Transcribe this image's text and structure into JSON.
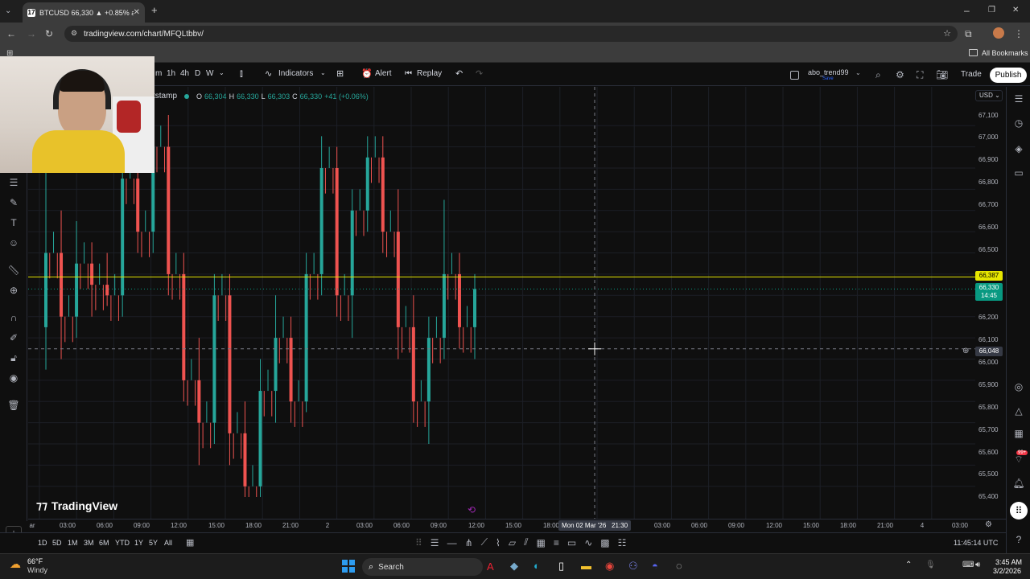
{
  "browser": {
    "tab_title": "BTCUSD 66,330 ▲ +0.85% abo...",
    "url": "tradingview.com/chart/MFQLtbbv/",
    "bookmarks_label": "All Bookmarks"
  },
  "toolbar": {
    "intervals": [
      "m",
      "1h",
      "4h",
      "D",
      "W"
    ],
    "indicators_label": "Indicators",
    "alert_label": "Alert",
    "replay_label": "Replay",
    "layout_name": "abo_trend99",
    "layout_sub": "Save",
    "trade_label": "Trade",
    "publish_label": "Publish"
  },
  "legend": {
    "exchange": "tstamp",
    "o_label": "O",
    "o_value": "66,304",
    "h_label": "H",
    "h_value": "66,330",
    "l_label": "L",
    "l_value": "66,303",
    "c_label": "C",
    "c_value": "66,330",
    "change": "+41 (+0.06%)"
  },
  "currency": "USD",
  "price_axis": {
    "ticks": [
      "67,100",
      "67,000",
      "66,900",
      "66,800",
      "66,700",
      "66,600",
      "66,500",
      "66,387",
      "66,330",
      "66,200",
      "66,100",
      "66,048",
      "66,000",
      "65,900",
      "65,800",
      "65,700",
      "65,600",
      "65,500",
      "65,400"
    ],
    "yellow_line_label": "66,387",
    "last_price_label": "66,330",
    "countdown_label": "14:45",
    "crosshair_label": "66,048"
  },
  "time_axis": {
    "ticks": [
      "ar",
      "03:00",
      "06:00",
      "09:00",
      "12:00",
      "15:00",
      "18:00",
      "21:00",
      "2",
      "03:00",
      "06:00",
      "09:00",
      "12:00",
      "15:00",
      "18:00",
      "03:00",
      "06:00",
      "09:00",
      "12:00",
      "15:00",
      "18:00",
      "21:00",
      "4",
      "03:00"
    ],
    "crosshair_label": "Mon 02 Mar '26   21:30"
  },
  "watermark": "TradingView",
  "bottombar": {
    "ranges": [
      "1D",
      "5D",
      "1M",
      "3M",
      "6M",
      "YTD",
      "1Y",
      "5Y",
      "All"
    ],
    "clock": "11:45:14 UTC"
  },
  "taskbar": {
    "weather_temp": "66°F",
    "weather_desc": "Windy",
    "search_label": "Search",
    "time": "3:45 AM",
    "date": "3/2/2026",
    "notif_badge": "99+"
  },
  "colors": {
    "up": "#26a69a",
    "down": "#ef5350",
    "yellow_line": "#e6e600",
    "last_price": "#089981",
    "chart_bg": "#0f0f0f"
  },
  "chart_data": {
    "type": "candlestick",
    "symbol": "BTCUSD",
    "ylim": [
      65350,
      67150
    ],
    "horizontal_line": 66387,
    "last_price": 66330,
    "crosshair_price": 66048,
    "crosshair_time": "Mon 02 Mar '26 21:30",
    "series": [
      {
        "c": "u",
        "o": 66150,
        "h": 66900,
        "l": 65950,
        "cl": 66500
      },
      {
        "c": "d",
        "o": 66500,
        "h": 66700,
        "l": 66000,
        "cl": 66200
      },
      {
        "c": "u",
        "o": 66200,
        "h": 66650,
        "l": 66100,
        "cl": 66450
      },
      {
        "c": "d",
        "o": 66450,
        "h": 66550,
        "l": 66200,
        "cl": 66350
      },
      {
        "c": "d",
        "o": 66350,
        "h": 66500,
        "l": 66250,
        "cl": 66300
      },
      {
        "c": "u",
        "o": 66300,
        "h": 67200,
        "l": 66200,
        "cl": 66850
      },
      {
        "c": "d",
        "o": 66850,
        "h": 67200,
        "l": 66500,
        "cl": 66600
      },
      {
        "c": "u",
        "o": 66600,
        "h": 67200,
        "l": 66500,
        "cl": 67000
      },
      {
        "c": "d",
        "o": 67000,
        "h": 67200,
        "l": 66300,
        "cl": 66400
      },
      {
        "c": "d",
        "o": 66400,
        "h": 66500,
        "l": 65800,
        "cl": 65900
      },
      {
        "c": "d",
        "o": 65900,
        "h": 66100,
        "l": 65500,
        "cl": 65700
      },
      {
        "c": "u",
        "o": 65700,
        "h": 66400,
        "l": 65600,
        "cl": 66300
      },
      {
        "c": "d",
        "o": 66300,
        "h": 66400,
        "l": 65500,
        "cl": 65650
      },
      {
        "c": "d",
        "o": 65650,
        "h": 65800,
        "l": 65350,
        "cl": 65400
      },
      {
        "c": "u",
        "o": 65400,
        "h": 66000,
        "l": 65350,
        "cl": 65850
      },
      {
        "c": "u",
        "o": 65850,
        "h": 66300,
        "l": 65700,
        "cl": 66100
      },
      {
        "c": "d",
        "o": 66100,
        "h": 66200,
        "l": 65700,
        "cl": 65800
      },
      {
        "c": "u",
        "o": 65800,
        "h": 66500,
        "l": 65750,
        "cl": 66400
      },
      {
        "c": "u",
        "o": 66400,
        "h": 67050,
        "l": 66300,
        "cl": 66900
      },
      {
        "c": "d",
        "o": 66900,
        "h": 67000,
        "l": 66200,
        "cl": 66300
      },
      {
        "c": "u",
        "o": 66300,
        "h": 66800,
        "l": 66100,
        "cl": 66700
      },
      {
        "c": "u",
        "o": 66700,
        "h": 67050,
        "l": 66600,
        "cl": 66950
      },
      {
        "c": "d",
        "o": 66950,
        "h": 67050,
        "l": 66500,
        "cl": 66600
      },
      {
        "c": "d",
        "o": 66600,
        "h": 66800,
        "l": 66000,
        "cl": 66150
      },
      {
        "c": "d",
        "o": 66150,
        "h": 66300,
        "l": 65700,
        "cl": 65800
      },
      {
        "c": "u",
        "o": 65800,
        "h": 66200,
        "l": 65600,
        "cl": 66100
      },
      {
        "c": "u",
        "o": 66100,
        "h": 66750,
        "l": 66000,
        "cl": 66400
      },
      {
        "c": "d",
        "o": 66400,
        "h": 66500,
        "l": 66050,
        "cl": 66150
      },
      {
        "c": "u",
        "o": 66150,
        "h": 66400,
        "l": 66000,
        "cl": 66330
      }
    ]
  }
}
